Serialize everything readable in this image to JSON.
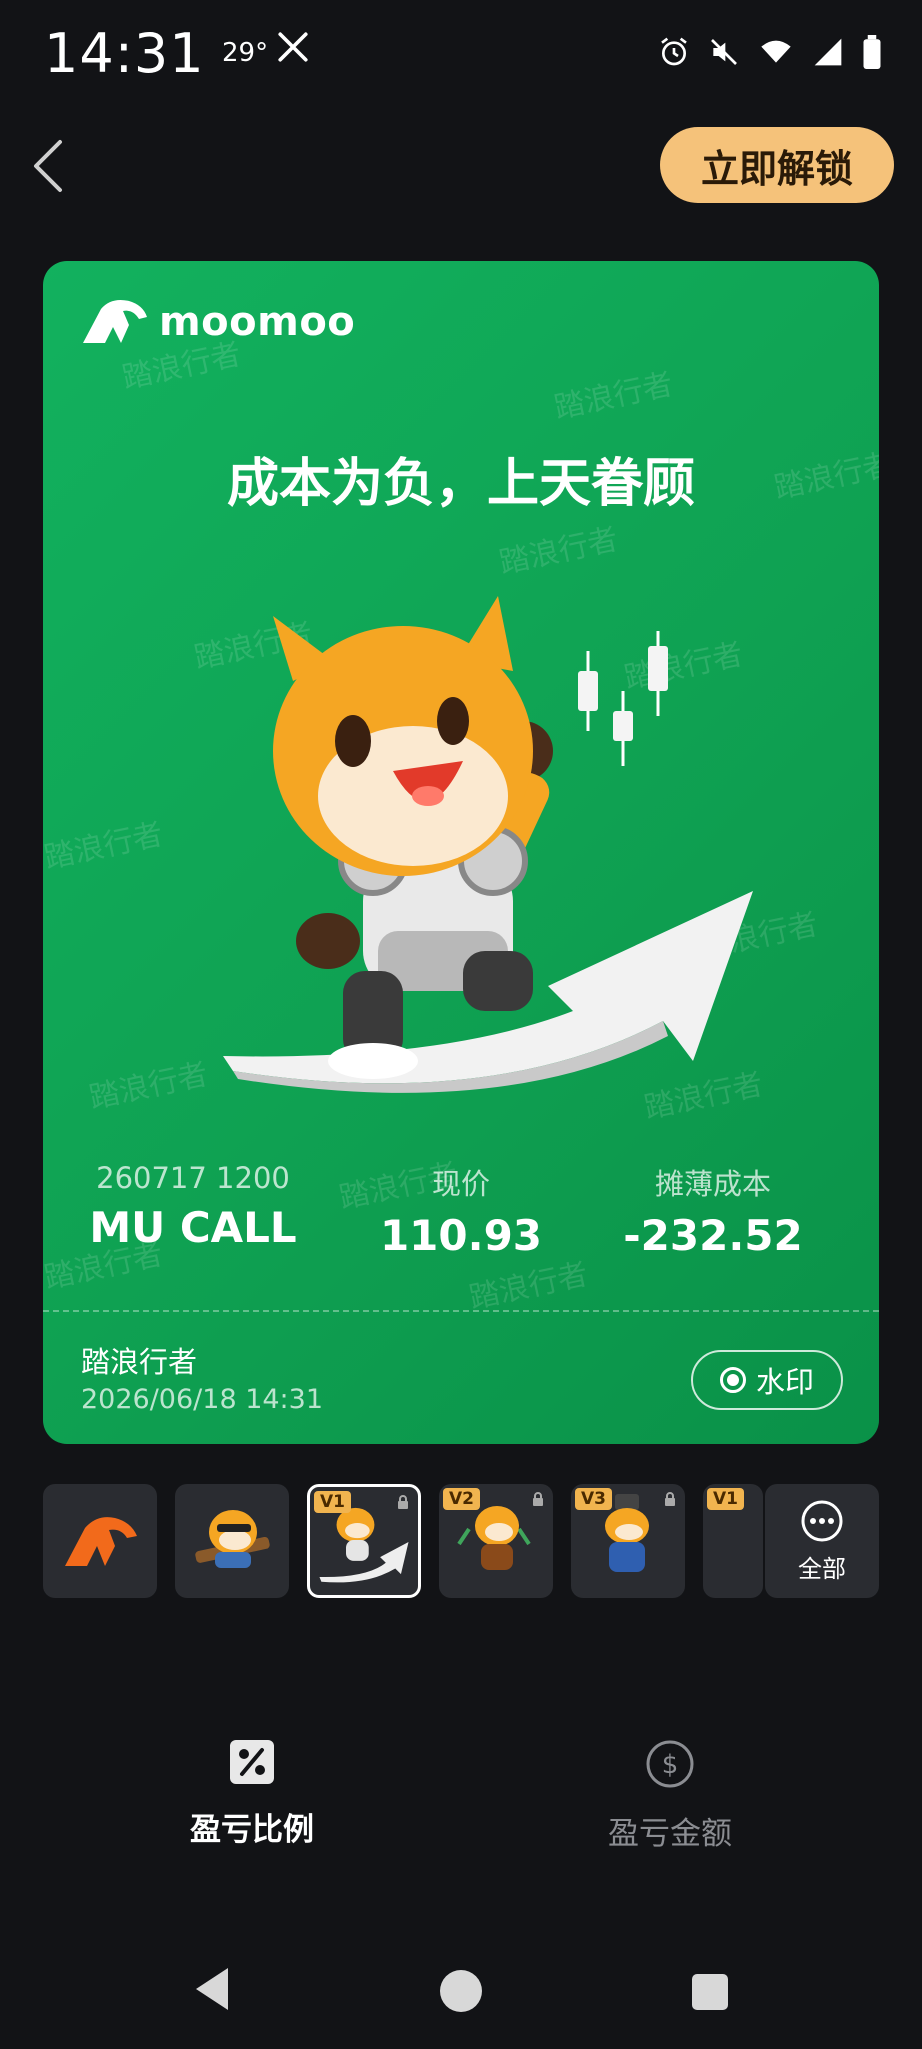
{
  "status_bar": {
    "time": "14:31",
    "temperature": "29°"
  },
  "header": {
    "unlock_label": "立即解锁"
  },
  "card": {
    "brand": "moomoo",
    "title": "成本为负，上天眷顾",
    "watermark_text": "踏浪行者",
    "contract": {
      "label": "260717 1200",
      "value": "MU CALL"
    },
    "price": {
      "label": "现价",
      "value": "110.93"
    },
    "cost": {
      "label": "摊薄成本",
      "value": "-232.52"
    },
    "username": "踏浪行者",
    "datetime": "2026/06/18 14:31",
    "watermark_toggle_label": "水印",
    "watermark_enabled": true
  },
  "thumbnails": {
    "items": [
      {
        "badge": ""
      },
      {
        "badge": ""
      },
      {
        "badge": "V1"
      },
      {
        "badge": "V2"
      },
      {
        "badge": "V3"
      },
      {
        "badge": "V1"
      }
    ],
    "selected_index": 2,
    "all_label": "全部"
  },
  "tabs": [
    {
      "label": "盈亏比例",
      "icon": "percent-icon",
      "active": true
    },
    {
      "label": "盈亏金额",
      "icon": "dollar-circle-icon",
      "active": false
    }
  ],
  "colors": {
    "card_green": "#0fa152",
    "unlock_bg": "#f5c27a",
    "mascot_orange": "#f5a623"
  }
}
